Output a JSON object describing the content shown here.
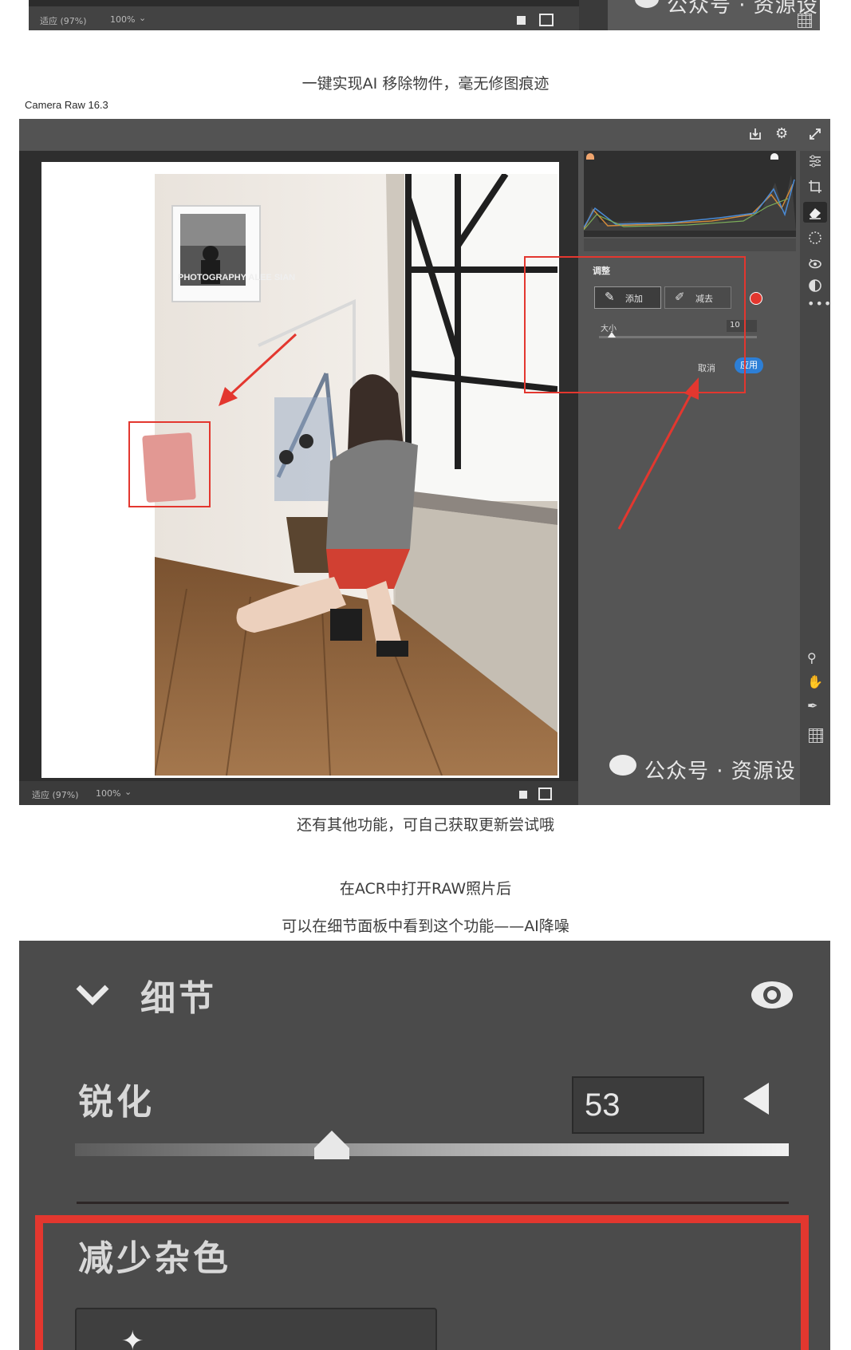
{
  "top_strip": {
    "fit_label": "适应 (97%)",
    "zoom_label": "100%",
    "watermark": "公众号 · 资源设"
  },
  "captions": {
    "remove_object": "一键实现AI 移除物件，毫无修图痕迹",
    "more_features": "还有其他功能，可自己获取更新尝试哦",
    "open_raw": "在ACR中打开RAW照片后",
    "detail_panel": "可以在细节面板中看到这个功能——AI降噪"
  },
  "camera_raw": {
    "title": "Camera Raw 16.3",
    "photo_poster_text": "PHOTOGRAPHY ALEE SIAN",
    "remove_panel": {
      "heading": "调整",
      "add_label": "添加",
      "subtract_label": "减去",
      "size_label": "大小",
      "size_value": "10",
      "size_fraction": 0.08,
      "cancel_label": "取消",
      "apply_label": "应用"
    },
    "footer": {
      "fit_label": "适应 (97%)",
      "zoom_label": "100%"
    },
    "watermark": "公众号 · 资源设"
  },
  "detail": {
    "section_title": "细节",
    "sharpen_label": "锐化",
    "sharpen_value": "53",
    "sharpen_fraction": 0.36,
    "noise_label": "减少杂色"
  },
  "colors": {
    "accent_blue": "#2d7fd6",
    "highlight_red": "#e3372f"
  }
}
